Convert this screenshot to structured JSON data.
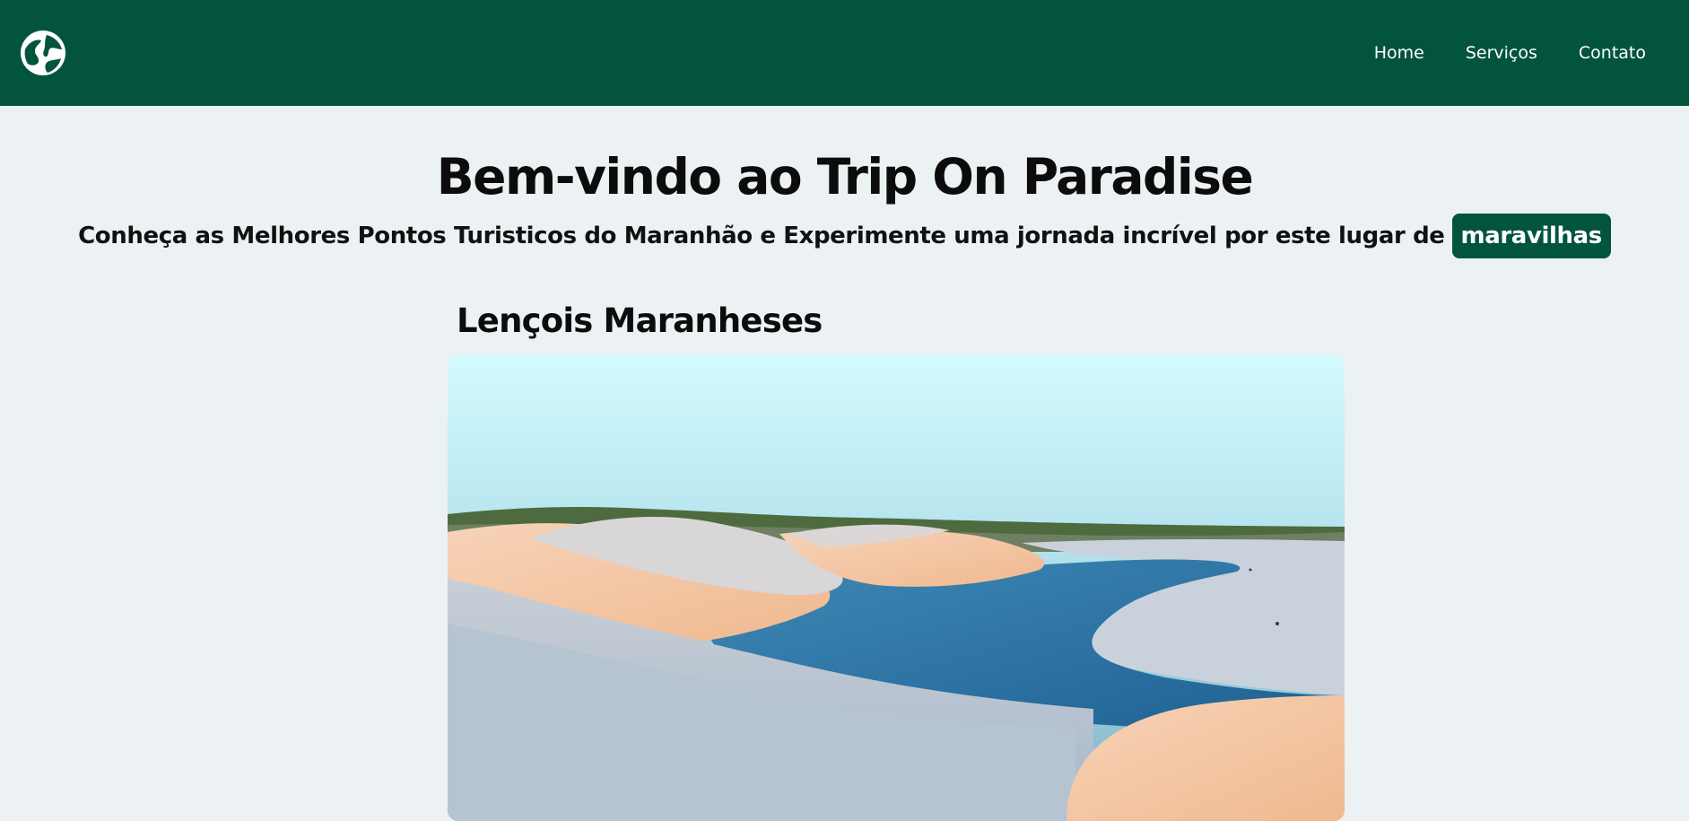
{
  "header": {
    "logo_icon": "globe-icon",
    "nav": [
      {
        "label": "Home"
      },
      {
        "label": "Serviços"
      },
      {
        "label": "Contato"
      }
    ]
  },
  "hero": {
    "title": "Bem-vindo ao Trip On Paradise",
    "subtitle": "Conheça as Melhores Pontos Turisticos do Maranhão e Experimente uma jornada incrível por este lugar de",
    "highlight": "maravilhas"
  },
  "destination": {
    "title": "Lençois Maranheses"
  },
  "colors": {
    "brand_green": "#03543d",
    "background": "#ecf1f3"
  }
}
